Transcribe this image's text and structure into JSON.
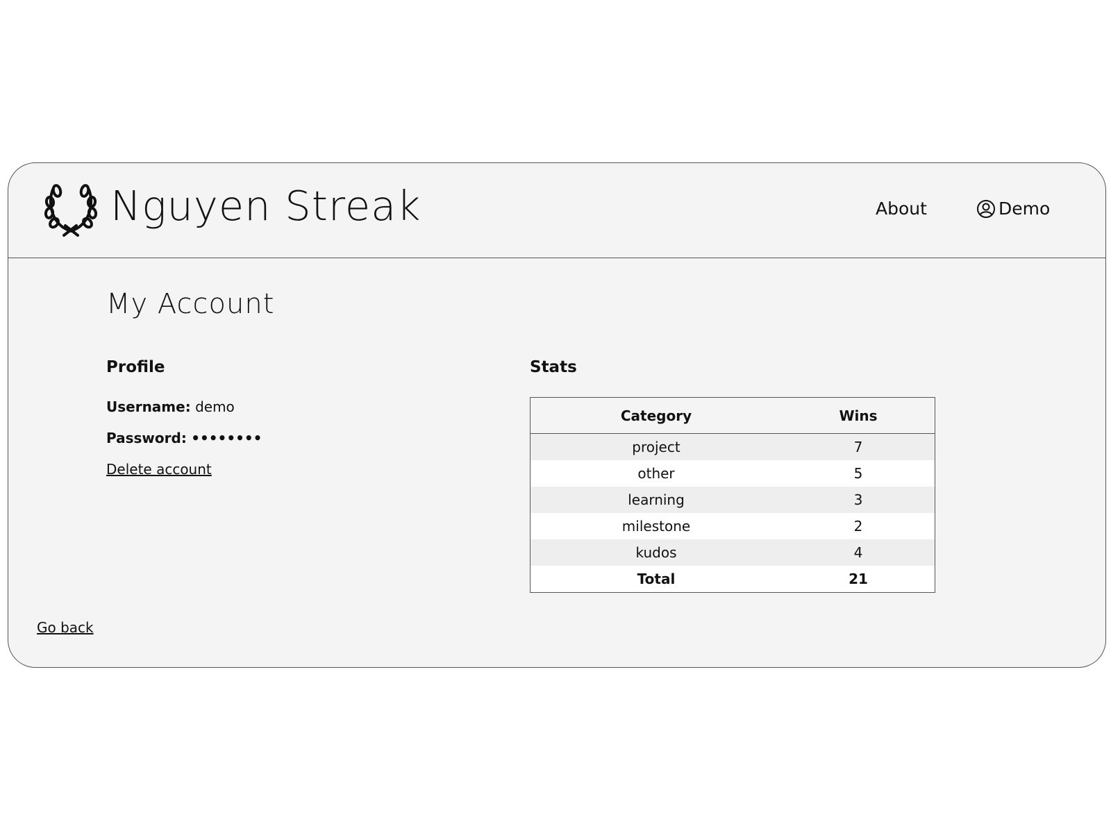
{
  "header": {
    "brand": "Nguyen Streak",
    "logo_icon": "laurel-wreath-icon",
    "nav": {
      "about_label": "About",
      "user_label": "Demo",
      "user_icon": "user-circle-icon"
    }
  },
  "main": {
    "title": "My Account",
    "profile": {
      "heading": "Profile",
      "username_label": "Username:",
      "username_value": "demo",
      "password_label": "Password:",
      "password_value": "••••••••",
      "delete_label": "Delete account"
    },
    "stats": {
      "heading": "Stats",
      "columns": [
        "Category",
        "Wins"
      ],
      "rows": [
        {
          "category": "project",
          "wins": "7"
        },
        {
          "category": "other",
          "wins": "5"
        },
        {
          "category": "learning",
          "wins": "3"
        },
        {
          "category": "milestone",
          "wins": "2"
        },
        {
          "category": "kudos",
          "wins": "4"
        }
      ],
      "total": {
        "label": "Total",
        "wins": "21"
      }
    },
    "go_back_label": "Go back"
  },
  "colors": {
    "panel_background": "#f4f4f4",
    "border": "#555555",
    "text": "#111111"
  }
}
